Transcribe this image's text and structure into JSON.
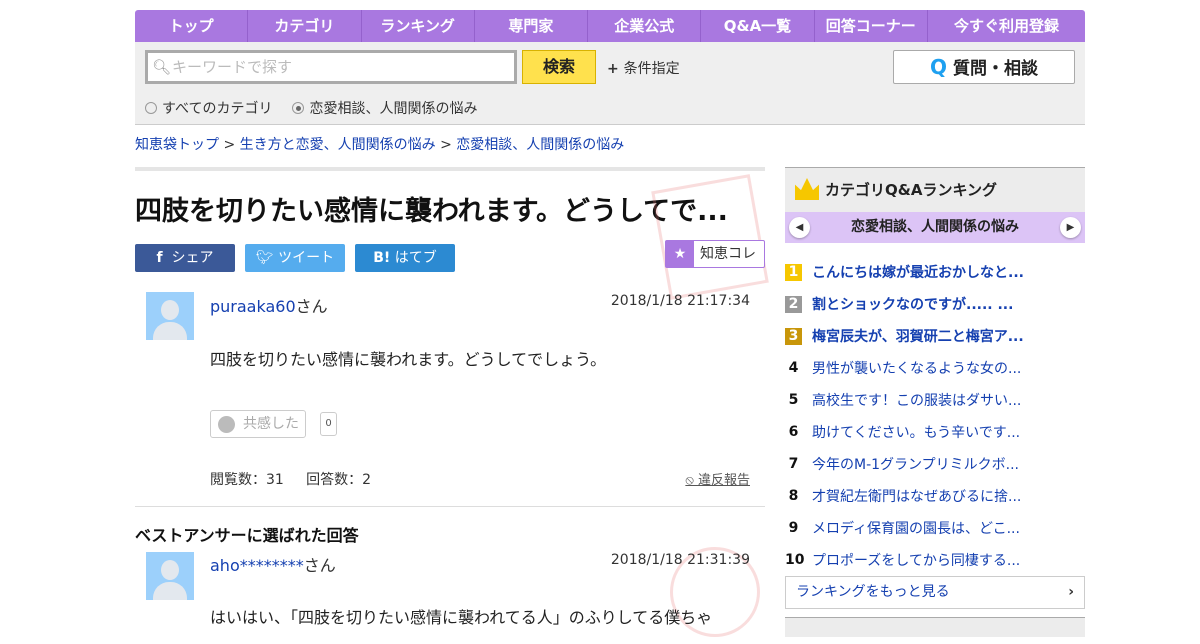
{
  "nav": [
    "トップ",
    "カテゴリ",
    "ランキング",
    "専門家",
    "企業公式",
    "Q&A一覧",
    "回答コーナー",
    "今すぐ利用登録"
  ],
  "search": {
    "placeholder": "キーワードで探す",
    "button": "検索",
    "condition": "条件指定",
    "ask_button": "質問・相談",
    "ask_icon": "Q",
    "scope_all": "すべてのカテゴリ",
    "scope_cat": "恋愛相談、人間関係の悩み"
  },
  "breadcrumb": [
    "知恵袋トップ",
    "生き方と恋愛、人間関係の悩み",
    "恋愛相談、人間関係の悩み"
  ],
  "question": {
    "title": "四肢を切りたい感情に襲われます。どうしてで...",
    "share": [
      "シェア",
      "ツイート",
      "はてブ"
    ],
    "chiekore": "知恵コレ",
    "user": "puraaka60",
    "san": "さん",
    "date": "2018/1/18  21:17:34",
    "body": "四肢を切りたい感情に襲われます。どうしてでしょう。",
    "empathy": "共感した",
    "empathy_count": "0",
    "views": "閲覧数：31",
    "answers": "回答数：2",
    "report": "違反報告"
  },
  "best": {
    "heading": "ベストアンサーに選ばれた回答",
    "user": "aho********",
    "san": "さん",
    "date": "2018/1/18  21:31:39",
    "body": "はいはい、「四肢を切りたい感情に襲われてる人」のふりしてる僕ちゃ"
  },
  "ranking": {
    "title": "カテゴリQ&Aランキング",
    "category": "恋愛相談、人間関係の悩み",
    "items": [
      {
        "n": "1",
        "t": "こんにちは嫁が最近おかしなと...",
        "color": "#f6c700"
      },
      {
        "n": "2",
        "t": "割とショックなのですが..... ...",
        "color": "#999999"
      },
      {
        "n": "3",
        "t": "梅宮辰夫が、羽賀研二と梅宮ア...",
        "color": "#c8960a"
      },
      {
        "n": "4",
        "t": "男性が襲いたくなるような女の..."
      },
      {
        "n": "5",
        "t": "高校生です！この服装はダサい..."
      },
      {
        "n": "6",
        "t": "助けてください。もう辛いです..."
      },
      {
        "n": "7",
        "t": "今年のM-1グランプリミルクボ..."
      },
      {
        "n": "8",
        "t": "才賀紀左衛門はなぜあびるに捨..."
      },
      {
        "n": "9",
        "t": "メロディ保育園の園長は、どこ..."
      },
      {
        "n": "10",
        "t": "プロポーズをしてから同棲する..."
      }
    ],
    "more": "ランキングをもっと見る"
  }
}
